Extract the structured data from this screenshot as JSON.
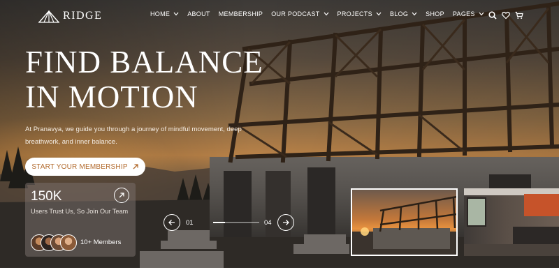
{
  "brand": {
    "name": "RIDGE",
    "logo_icon": "tent-icon"
  },
  "nav": {
    "items": [
      {
        "label": "HOME",
        "dropdown": true
      },
      {
        "label": "ABOUT",
        "dropdown": false
      },
      {
        "label": "MEMBERSHIP",
        "dropdown": false
      },
      {
        "label": "OUR PODCAST",
        "dropdown": true
      },
      {
        "label": "PROJECTS",
        "dropdown": true
      },
      {
        "label": "BLOG",
        "dropdown": true
      },
      {
        "label": "SHOP",
        "dropdown": false
      },
      {
        "label": "PAGES",
        "dropdown": true
      }
    ],
    "icons": [
      "search-icon",
      "heart-icon",
      "cart-icon"
    ]
  },
  "hero": {
    "headline_line1": "FIND BALANCE",
    "headline_line2": "IN MOTION",
    "subtitle": "At Pranavya, we guide you through a journey of mindful movement, deep breathwork, and inner balance.",
    "cta_label": "START YOUR MEMBERSHIP"
  },
  "members_card": {
    "stat": "150K",
    "text": "Users Trust Us, So Join Our Team",
    "count_label": "10+ Members"
  },
  "slider": {
    "current": "01",
    "total": "04",
    "progress": 0.25
  },
  "colors": {
    "accent": "#b26a2d",
    "text_light": "#ffffff",
    "card_overlay": "rgba(120,110,105,0.55)"
  }
}
